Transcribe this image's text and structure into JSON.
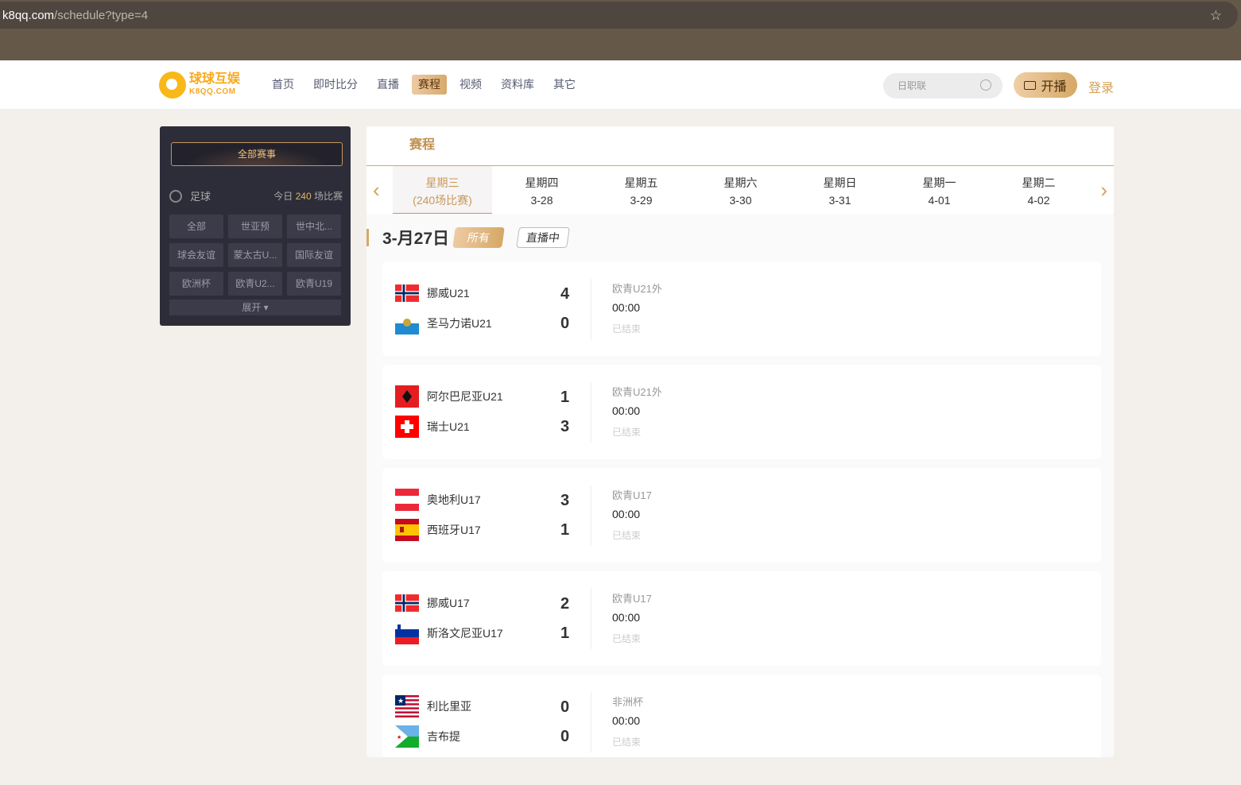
{
  "browser": {
    "url_host": "k8qq.com",
    "url_path": "/schedule?type=4",
    "bookmark_icon": "star-icon"
  },
  "header": {
    "logo": {
      "cn": "球球互娱",
      "en": "K8QQ.COM"
    },
    "nav": [
      {
        "label": "首页"
      },
      {
        "label": "即时比分"
      },
      {
        "label": "直播"
      },
      {
        "label": "赛程",
        "active": true
      },
      {
        "label": "视频"
      },
      {
        "label": "资料库"
      },
      {
        "label": "其它"
      }
    ],
    "search_placeholder": "日职联",
    "live_label": "开播",
    "login_label": "登录"
  },
  "sidebar": {
    "all_label": "全部赛事",
    "sport": "足球",
    "today_prefix": "今日",
    "today_count": "240",
    "today_suffix": "场比赛",
    "tags": [
      "全部",
      "世亚预",
      "世中北...",
      "球会友谊",
      "蒙太古U...",
      "国际友谊",
      "欧洲杯",
      "欧青U2...",
      "欧青U19"
    ],
    "expand_label": "展开 ▾"
  },
  "main": {
    "title": "赛程",
    "days": [
      {
        "weekday": "星期三",
        "sub": "(240场比赛)",
        "active": true
      },
      {
        "weekday": "星期四",
        "sub": "3-28"
      },
      {
        "weekday": "星期五",
        "sub": "3-29"
      },
      {
        "weekday": "星期六",
        "sub": "3-30"
      },
      {
        "weekday": "星期日",
        "sub": "3-31"
      },
      {
        "weekday": "星期一",
        "sub": "4-01"
      },
      {
        "weekday": "星期二",
        "sub": "4-02"
      }
    ],
    "date_label": "3-月27日",
    "filter_all": "所有",
    "filter_live": "直播中",
    "matches": [
      {
        "home": "挪威U21",
        "home_flag": "norway",
        "home_score": "4",
        "away": "圣马力诺U21",
        "away_flag": "san-marino",
        "away_score": "0",
        "league": "欧青U21外",
        "time": "00:00",
        "status": "已结束"
      },
      {
        "home": "阿尔巴尼亚U21",
        "home_flag": "albania",
        "home_score": "1",
        "away": "瑞士U21",
        "away_flag": "switzerland",
        "away_score": "3",
        "league": "欧青U21外",
        "time": "00:00",
        "status": "已结束"
      },
      {
        "home": "奥地利U17",
        "home_flag": "austria",
        "home_score": "3",
        "away": "西班牙U17",
        "away_flag": "spain",
        "away_score": "1",
        "league": "欧青U17",
        "time": "00:00",
        "status": "已结束"
      },
      {
        "home": "挪威U17",
        "home_flag": "norway",
        "home_score": "2",
        "away": "斯洛文尼亚U17",
        "away_flag": "slovenia",
        "away_score": "1",
        "league": "欧青U17",
        "time": "00:00",
        "status": "已结束"
      },
      {
        "home": "利比里亚",
        "home_flag": "liberia",
        "home_score": "0",
        "away": "吉布提",
        "away_flag": "djibouti",
        "away_score": "0",
        "league": "非洲杯",
        "time": "00:00",
        "status": "已结束"
      }
    ]
  },
  "colors": {
    "accent": "#d6a865",
    "sidebar_bg": "#2d2d3a",
    "chrome": "#655848"
  }
}
